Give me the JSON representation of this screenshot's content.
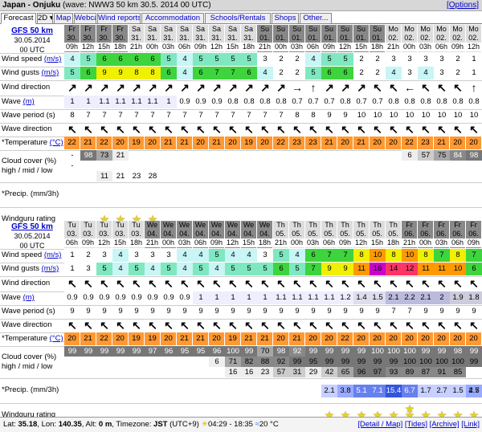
{
  "title": {
    "location": "Japan - Onjuku",
    "info": "(wave: NWW3 50 km 30.5. 2014 00 UTC)",
    "options": "[Options]"
  },
  "tabs": [
    "Forecast",
    "2D",
    "Map",
    "Webcams",
    "Wind reports",
    "Accommodation",
    "Schools/Rentals",
    "Shops",
    "Other..."
  ],
  "labels": {
    "wind_speed": "Wind speed",
    "wind_gusts": "Wind gusts",
    "unit_ms": "(m/s)",
    "wind_dir": "Wind direction",
    "wave": "Wave",
    "wave_unit": "(m)",
    "wave_period": "Wave period (s)",
    "wave_dir": "Wave direction",
    "temperature": "*Temperature",
    "temp_unit": "(°C)",
    "cloud1": "Cloud cover (%)",
    "cloud2": "high / mid / low",
    "precip": "*Precip. (mm/3h)",
    "rating": "Windguru rating"
  },
  "blocks": [
    {
      "model": "GFS 50 km",
      "date": "30.05.2014",
      "utc": "00 UTC",
      "days": [
        "Fr",
        "Fr",
        "Fr",
        "Fr",
        "Sa",
        "Sa",
        "Sa",
        "Sa",
        "Sa",
        "Sa",
        "Sa",
        "Sa",
        "Su",
        "Su",
        "Su",
        "Su",
        "Su",
        "Su",
        "Su",
        "Su",
        "Mo",
        "Mo",
        "Mo",
        "Mo",
        "Mo",
        "Mo"
      ],
      "dates": [
        "30.",
        "30.",
        "30.",
        "30.",
        "31.",
        "31.",
        "31.",
        "31.",
        "31.",
        "31.",
        "31.",
        "31.",
        "01.",
        "01.",
        "01.",
        "01.",
        "01.",
        "01.",
        "01.",
        "01.",
        "02.",
        "02.",
        "02.",
        "02.",
        "02.",
        "02."
      ],
      "hours": [
        "09h",
        "12h",
        "15h",
        "18h",
        "21h",
        "00h",
        "03h",
        "06h",
        "09h",
        "12h",
        "15h",
        "18h",
        "21h",
        "00h",
        "03h",
        "06h",
        "09h",
        "12h",
        "15h",
        "18h",
        "21h",
        "00h",
        "03h",
        "06h",
        "09h",
        "12h"
      ],
      "wind_speed": [
        "4",
        "5",
        "6",
        "6",
        "6",
        "6",
        "5",
        "4",
        "5",
        "5",
        "5",
        "5",
        "3",
        "2",
        "2",
        "4",
        "5",
        "5",
        "2",
        "2",
        "3",
        "3",
        "3",
        "3",
        "2",
        "1"
      ],
      "wind_gusts": [
        "5",
        "6",
        "9",
        "9",
        "8",
        "8",
        "6",
        "4",
        "6",
        "7",
        "7",
        "6",
        "4",
        "2",
        "2",
        "5",
        "6",
        "6",
        "2",
        "2",
        "4",
        "3",
        "4",
        "3",
        "2",
        "1"
      ],
      "wind_dir": [
        "↗",
        "↗",
        "↗",
        "↗",
        "↗",
        "↗",
        "↗",
        "↗",
        "↗",
        "↗",
        "↗",
        "↗",
        "↗",
        "↗",
        "→",
        "↑",
        "↗",
        "↗",
        "↗",
        "↖",
        "↖",
        "←",
        "↖",
        "↖",
        "↖",
        "↑"
      ],
      "wave": [
        "1",
        "1",
        "1.1",
        "1.1",
        "1.1",
        "1.1",
        "1",
        "0.9",
        "0.9",
        "0.9",
        "0.8",
        "0.8",
        "0.8",
        "0.8",
        "0.7",
        "0.7",
        "0.7",
        "0.8",
        "0.7",
        "0.7",
        "0.8",
        "0.8",
        "0.8",
        "0.8",
        "0.8",
        "0.8"
      ],
      "wave_period": [
        "8",
        "7",
        "7",
        "7",
        "7",
        "7",
        "7",
        "7",
        "7",
        "7",
        "7",
        "7",
        "7",
        "7",
        "8",
        "8",
        "9",
        "9",
        "10",
        "10",
        "10",
        "10",
        "10",
        "10",
        "10",
        "10"
      ],
      "wave_dir": [
        "↖",
        "↖",
        "↖",
        "↖",
        "↖",
        "↖",
        "↖",
        "↖",
        "↖",
        "↖",
        "↖",
        "↖",
        "↖",
        "↖",
        "↖",
        "↖",
        "↖",
        "↖",
        "↖",
        "↖",
        "↖",
        "↖",
        "↖",
        "↖",
        "↖",
        "↖"
      ],
      "temp": [
        "22",
        "21",
        "22",
        "20",
        "19",
        "20",
        "21",
        "21",
        "20",
        "21",
        "20",
        "19",
        "20",
        "22",
        "23",
        "23",
        "21",
        "20",
        "21",
        "20",
        "20",
        "22",
        "23",
        "21",
        "20",
        "20"
      ],
      "cloud_high": [
        "-",
        "98",
        "73",
        "21",
        "",
        "",
        "",
        "",
        "",
        "",
        "",
        "",
        "",
        "",
        "",
        "",
        "",
        "",
        "",
        "",
        "",
        "6",
        "57",
        "75",
        "84",
        "98"
      ],
      "cloud_mid": [
        "-",
        "",
        "",
        "",
        "",
        "",
        "",
        "",
        "",
        "",
        "",
        "",
        "",
        "",
        "",
        "",
        "",
        "",
        "",
        "",
        "",
        "",
        "",
        "",
        "",
        ""
      ],
      "cloud_low": [
        "",
        "",
        "11",
        "",
        "",
        "",
        "",
        "",
        "",
        "",
        "",
        "",
        "",
        "",
        "",
        "",
        "",
        "",
        "",
        "",
        "",
        "",
        "",
        "",
        "",
        ""
      ],
      "cloud_low2": [
        "",
        "",
        "",
        "21",
        "23",
        "28",
        "",
        "",
        "",
        "",
        "",
        "",
        "",
        "",
        "",
        "",
        "",
        "",
        "",
        "",
        "",
        "",
        "",
        "",
        "",
        ""
      ],
      "precip": [
        "",
        "",
        "",
        "",
        "",
        "",
        "",
        "",
        "",
        "",
        "",
        "",
        "",
        "",
        "",
        "",
        "",
        "",
        "",
        "",
        "",
        "",
        "",
        "",
        "",
        ""
      ],
      "rating": [
        0,
        0,
        1,
        1,
        1,
        1,
        0,
        0,
        0,
        0,
        0,
        0,
        0,
        0,
        0,
        0,
        0,
        0,
        0,
        0,
        0,
        0,
        0,
        0,
        0,
        0
      ]
    },
    {
      "model": "GFS 50 km",
      "date": "30.05.2014",
      "utc": "00 UTC",
      "days": [
        "Tu",
        "Tu",
        "Tu",
        "Tu",
        "Tu",
        "We",
        "We",
        "We",
        "We",
        "We",
        "We",
        "We",
        "We",
        "Th",
        "Th",
        "Th",
        "Th",
        "Th",
        "Th",
        "Th",
        "Th",
        "Fr",
        "Fr",
        "Fr",
        "Fr",
        "Fr"
      ],
      "dates": [
        "03.",
        "03.",
        "03.",
        "03.",
        "03.",
        "04.",
        "04.",
        "04.",
        "04.",
        "04.",
        "04.",
        "04.",
        "04.",
        "05.",
        "05.",
        "05.",
        "05.",
        "05.",
        "05.",
        "05.",
        "05.",
        "06.",
        "06.",
        "06.",
        "06.",
        "06."
      ],
      "hours": [
        "06h",
        "09h",
        "12h",
        "15h",
        "18h",
        "21h",
        "00h",
        "03h",
        "06h",
        "09h",
        "12h",
        "15h",
        "18h",
        "21h",
        "00h",
        "03h",
        "06h",
        "09h",
        "12h",
        "15h",
        "18h",
        "21h",
        "00h",
        "03h",
        "06h",
        "09h"
      ],
      "wind_speed": [
        "1",
        "2",
        "3",
        "4",
        "3",
        "3",
        "3",
        "4",
        "4",
        "5",
        "4",
        "4",
        "3",
        "5",
        "4",
        "6",
        "7",
        "7",
        "8",
        "10",
        "8",
        "10",
        "8",
        "7",
        "8",
        "7"
      ],
      "wind_gusts": [
        "1",
        "3",
        "5",
        "4",
        "5",
        "4",
        "5",
        "4",
        "5",
        "4",
        "5",
        "5",
        "5",
        "6",
        "5",
        "7",
        "9",
        "9",
        "11",
        "16",
        "14",
        "12",
        "11",
        "11",
        "10",
        "6"
      ],
      "wind_dir": [
        "↖",
        "↖",
        "↖",
        "↖",
        "↖",
        "↖",
        "↖",
        "↖",
        "↖",
        "↖",
        "↖",
        "↖",
        "↖",
        "↖",
        "↖",
        "↖",
        "↖",
        "↖",
        "↖",
        "↖",
        "↖",
        "↖",
        "↖",
        "↖",
        "↖",
        "↖"
      ],
      "wave": [
        "0.9",
        "0.9",
        "0.9",
        "0.9",
        "0.9",
        "0.9",
        "0.9",
        "0.9",
        "1",
        "1",
        "1",
        "1",
        "1",
        "1.1",
        "1.1",
        "1.1",
        "1.1",
        "1.2",
        "1.4",
        "1.5",
        "2.1",
        "2.2",
        "2.1",
        "2",
        "1.9",
        "1.8"
      ],
      "wave_period": [
        "9",
        "9",
        "9",
        "9",
        "9",
        "9",
        "9",
        "9",
        "9",
        "9",
        "9",
        "9",
        "9",
        "9",
        "9",
        "9",
        "9",
        "9",
        "9",
        "9",
        "7",
        "7",
        "9",
        "9",
        "9",
        "9"
      ],
      "wave_dir": [
        "↖",
        "↖",
        "↖",
        "↖",
        "↖",
        "↖",
        "↖",
        "↖",
        "↖",
        "↖",
        "↖",
        "↖",
        "↖",
        "↖",
        "↖",
        "↖",
        "↖",
        "↖",
        "↖",
        "↖",
        "↖",
        "↖",
        "↖",
        "↖",
        "↖",
        "↖"
      ],
      "temp": [
        "20",
        "21",
        "22",
        "20",
        "19",
        "19",
        "20",
        "21",
        "21",
        "20",
        "19",
        "21",
        "21",
        "20",
        "21",
        "20",
        "20",
        "22",
        "20",
        "20",
        "20",
        "20",
        "20",
        "20",
        "20",
        "20"
      ],
      "cloud_high": [
        "99",
        "99",
        "99",
        "99",
        "99",
        "97",
        "96",
        "95",
        "95",
        "96",
        "100",
        "99",
        "70",
        "98",
        "92",
        "99",
        "99",
        "99",
        "99",
        "100",
        "100",
        "100",
        "99",
        "99",
        "98",
        "99"
      ],
      "cloud_mid": [
        "",
        "",
        "",
        "",
        "",
        "",
        "",
        "",
        "",
        "6",
        "71",
        "82",
        "88",
        "92",
        "99",
        "95",
        "99",
        "99",
        "99",
        "99",
        "99",
        "100",
        "100",
        "100",
        "100",
        "99"
      ],
      "cloud_low": [
        "",
        "",
        "",
        "",
        "",
        "",
        "",
        "",
        "",
        "",
        "16",
        "16",
        "23",
        "57",
        "31",
        "29",
        "42",
        "65",
        "96",
        "97",
        "93",
        "89",
        "87",
        "91",
        "85",
        ""
      ],
      "precip": [
        "",
        "",
        "",
        "",
        "",
        "",
        "",
        "",
        "",
        "",
        "",
        "",
        "",
        "",
        "",
        "",
        "2.1",
        "3.8",
        "5.1",
        "7.1",
        "15.4",
        "6.7",
        "1.7",
        "2.7",
        "1.5",
        "4.7"
      ],
      "precip_extra": [
        "",
        "",
        "",
        "",
        "",
        "",
        "",
        "",
        "",
        "",
        "",
        "",
        "",
        "",
        "",
        "",
        "",
        "",
        "",
        "",
        "",
        "",
        "",
        "",
        "",
        "2.5"
      ],
      "rating": [
        0,
        0,
        0,
        0,
        0,
        0,
        0,
        0,
        0,
        0,
        0,
        0,
        0,
        0,
        0,
        0,
        1,
        1,
        1,
        1,
        1,
        3,
        1,
        1,
        1,
        1
      ]
    }
  ],
  "footer": {
    "lat_label": "Lat:",
    "lat": "35.18",
    "lon_label": "Lon:",
    "lon": "140.35",
    "alt_label": "Alt:",
    "alt": "0 m",
    "tz_label": "Timezone:",
    "tz": "JST",
    "tz_offset": "(UTC+9)",
    "sun": "04:29 - 18:35",
    "sea_temp": "20 °C",
    "links": [
      "[Detail / Map]",
      "[Tides]",
      "[Archive]",
      "[Link]"
    ]
  },
  "colors": {
    "wind_low": "#c8f5f5",
    "wind_mid": "#7fe8c0",
    "wind_green": "#3ed43e",
    "wind_yellow": "#f0f000",
    "wind_orange": "#ff9900",
    "wind_red": "#ff3366",
    "wind_purple": "#cc00cc",
    "temp": "#ff9933",
    "cloud_dark": "#888888"
  }
}
